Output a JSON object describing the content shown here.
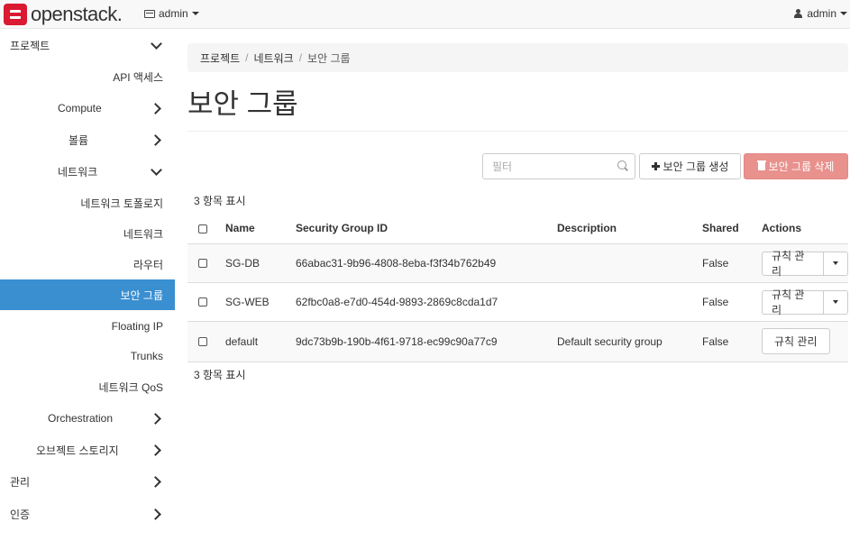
{
  "topbar": {
    "logo": "openstack.",
    "project": "admin",
    "user": "admin"
  },
  "sidebar": {
    "items": [
      {
        "label": "프로젝트",
        "chevron": "down"
      },
      {
        "label": "API 액세스",
        "chevron": ""
      },
      {
        "label": "Compute",
        "chevron": "right"
      },
      {
        "label": "볼륨",
        "chevron": "right"
      },
      {
        "label": "네트워크",
        "chevron": "down"
      },
      {
        "label": "네트워크 토폴로지",
        "chevron": ""
      },
      {
        "label": "네트워크",
        "chevron": ""
      },
      {
        "label": "라우터",
        "chevron": ""
      },
      {
        "label": "보안 그룹",
        "chevron": "",
        "active": true
      },
      {
        "label": "Floating IP",
        "chevron": ""
      },
      {
        "label": "Trunks",
        "chevron": ""
      },
      {
        "label": "네트워크 QoS",
        "chevron": ""
      },
      {
        "label": "Orchestration",
        "chevron": "right"
      },
      {
        "label": "오브젝트 스토리지",
        "chevron": "right"
      },
      {
        "label": "관리",
        "chevron": "right"
      },
      {
        "label": "인증",
        "chevron": "right"
      }
    ]
  },
  "breadcrumb": {
    "items": [
      "프로젝트",
      "네트워크",
      "보안 그룹"
    ]
  },
  "page_title": "보안 그룹",
  "toolbar": {
    "filter_placeholder": "필터",
    "create_label": "보안 그룹 생성",
    "delete_label": "보안 그룹 삭제"
  },
  "table": {
    "count_top": "3 항목 표시",
    "count_bottom": "3 항목 표시",
    "headers": [
      "Name",
      "Security Group ID",
      "Description",
      "Shared",
      "Actions"
    ],
    "rows": [
      {
        "name": "SG-DB",
        "id": "66abac31-9b96-4808-8eba-f3f34b762b49",
        "description": "",
        "shared": "False",
        "action": "규칙 관리",
        "has_dropdown": true
      },
      {
        "name": "SG-WEB",
        "id": "62fbc0a8-e7d0-454d-9893-2869c8cda1d7",
        "description": "",
        "shared": "False",
        "action": "규칙 관리",
        "has_dropdown": true
      },
      {
        "name": "default",
        "id": "9dc73b9b-190b-4f61-9718-ec99c90a77c9",
        "description": "Default security group",
        "shared": "False",
        "action": "규칙 관리",
        "has_dropdown": false
      }
    ]
  },
  "colors": {
    "active_nav": "#3a8fd1",
    "danger_button": "#e8918d",
    "logo": "#da1a32"
  }
}
